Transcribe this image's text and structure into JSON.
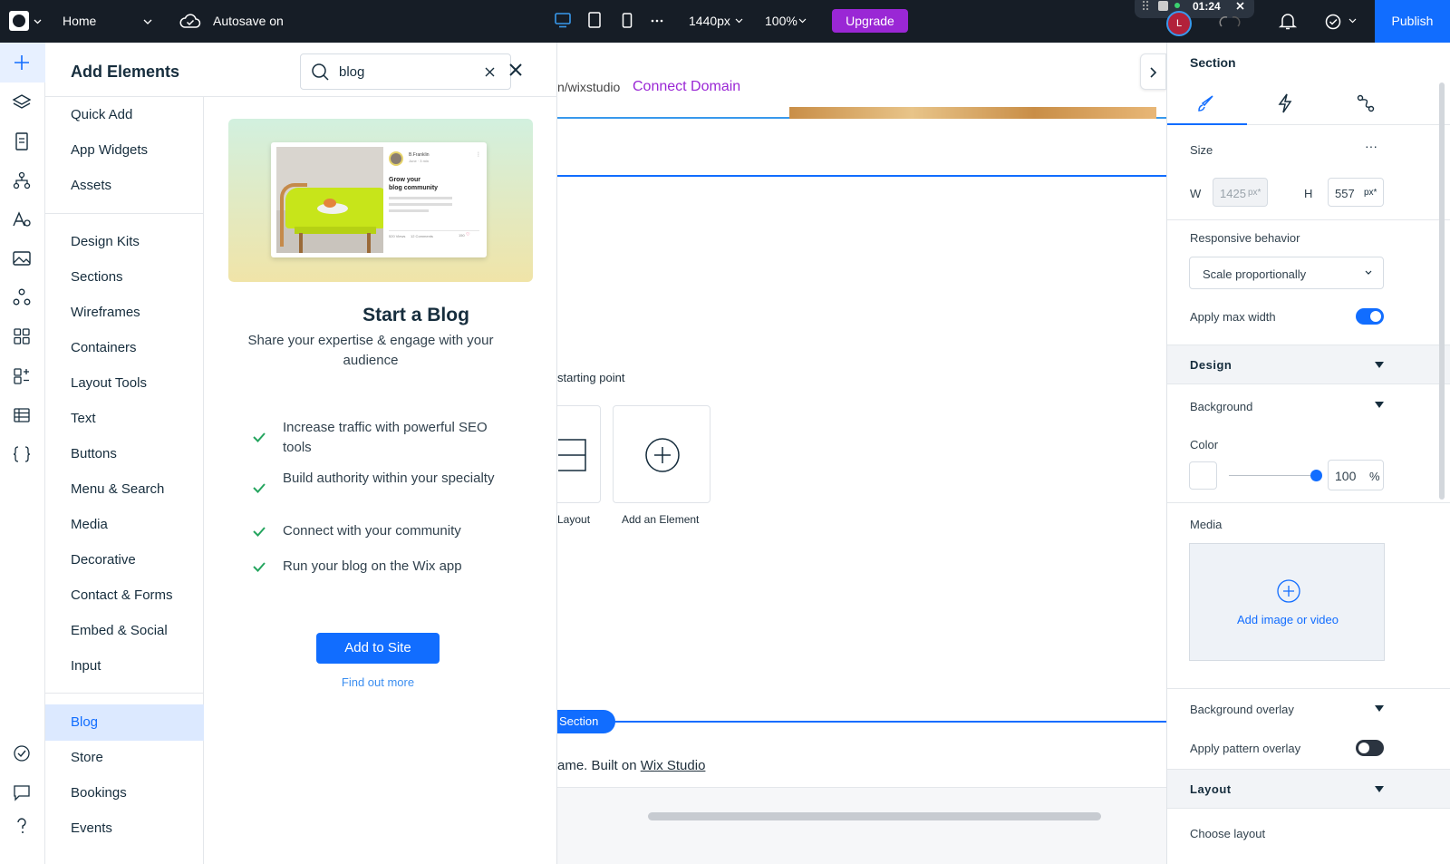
{
  "topbar": {
    "page_name": "Home",
    "autosave": "Autosave on",
    "width_value": "1440px",
    "zoom": "100%",
    "upgrade": "Upgrade",
    "publish": "Publish",
    "timer": "01:24",
    "avatar_initial": "L",
    "colors": {
      "bar": "#161d26",
      "upgrade": "#9a27d5",
      "publish": "#116dff"
    }
  },
  "add_panel": {
    "title": "Add Elements",
    "search_value": "blog",
    "categories_top": [
      "Quick Add",
      "App Widgets",
      "Assets"
    ],
    "categories_mid": [
      "Design Kits",
      "Sections",
      "Wireframes",
      "Containers",
      "Layout Tools",
      "Text",
      "Buttons",
      "Menu & Search",
      "Media",
      "Decorative",
      "Contact & Forms",
      "Embed & Social",
      "Input"
    ],
    "categories_apps": [
      "Blog",
      "Store",
      "Bookings",
      "Events"
    ],
    "active_category": "Blog",
    "preview_card": {
      "author": "B.Franklin",
      "meta": "June · 3 min",
      "headline_line1": "Grow your",
      "headline_line2": "blog community",
      "views": "520 Views",
      "comments": "12 Comments",
      "likes": "150"
    },
    "blog_title": "Start a Blog",
    "blog_subtitle": "Share your expertise & engage with your audience",
    "features": [
      "Increase traffic with powerful SEO tools",
      "Build authority within your specialty",
      "Connect with your community",
      "Run your blog on the Wix app"
    ],
    "add_button": "Add to Site",
    "find_more": "Find out more"
  },
  "canvas": {
    "url_fragment": "n/wixstudio",
    "connect_domain": "Connect Domain",
    "starting_point": "starting point",
    "tile_layout_label": "Layout",
    "tile_add_label": "Add an Element",
    "section_tag": "Section",
    "footer_prefix": "ame. Built on",
    "footer_link": "Wix Studio"
  },
  "inspector": {
    "title": "Section",
    "size_label": "Size",
    "w_label": "W",
    "w_value": "1425",
    "h_label": "H",
    "h_value": "557",
    "unit": "px*",
    "responsive_label": "Responsive behavior",
    "responsive_value": "Scale proportionally",
    "max_width_label": "Apply max width",
    "max_width_on": true,
    "design_label": "Design",
    "background_label": "Background",
    "color_label": "Color",
    "opacity_value": "100",
    "opacity_unit": "%",
    "media_label": "Media",
    "media_add": "Add image or video",
    "overlay_label": "Background overlay",
    "pattern_label": "Apply pattern overlay",
    "pattern_on": false,
    "layout_label": "Layout",
    "choose_layout": "Choose layout"
  }
}
